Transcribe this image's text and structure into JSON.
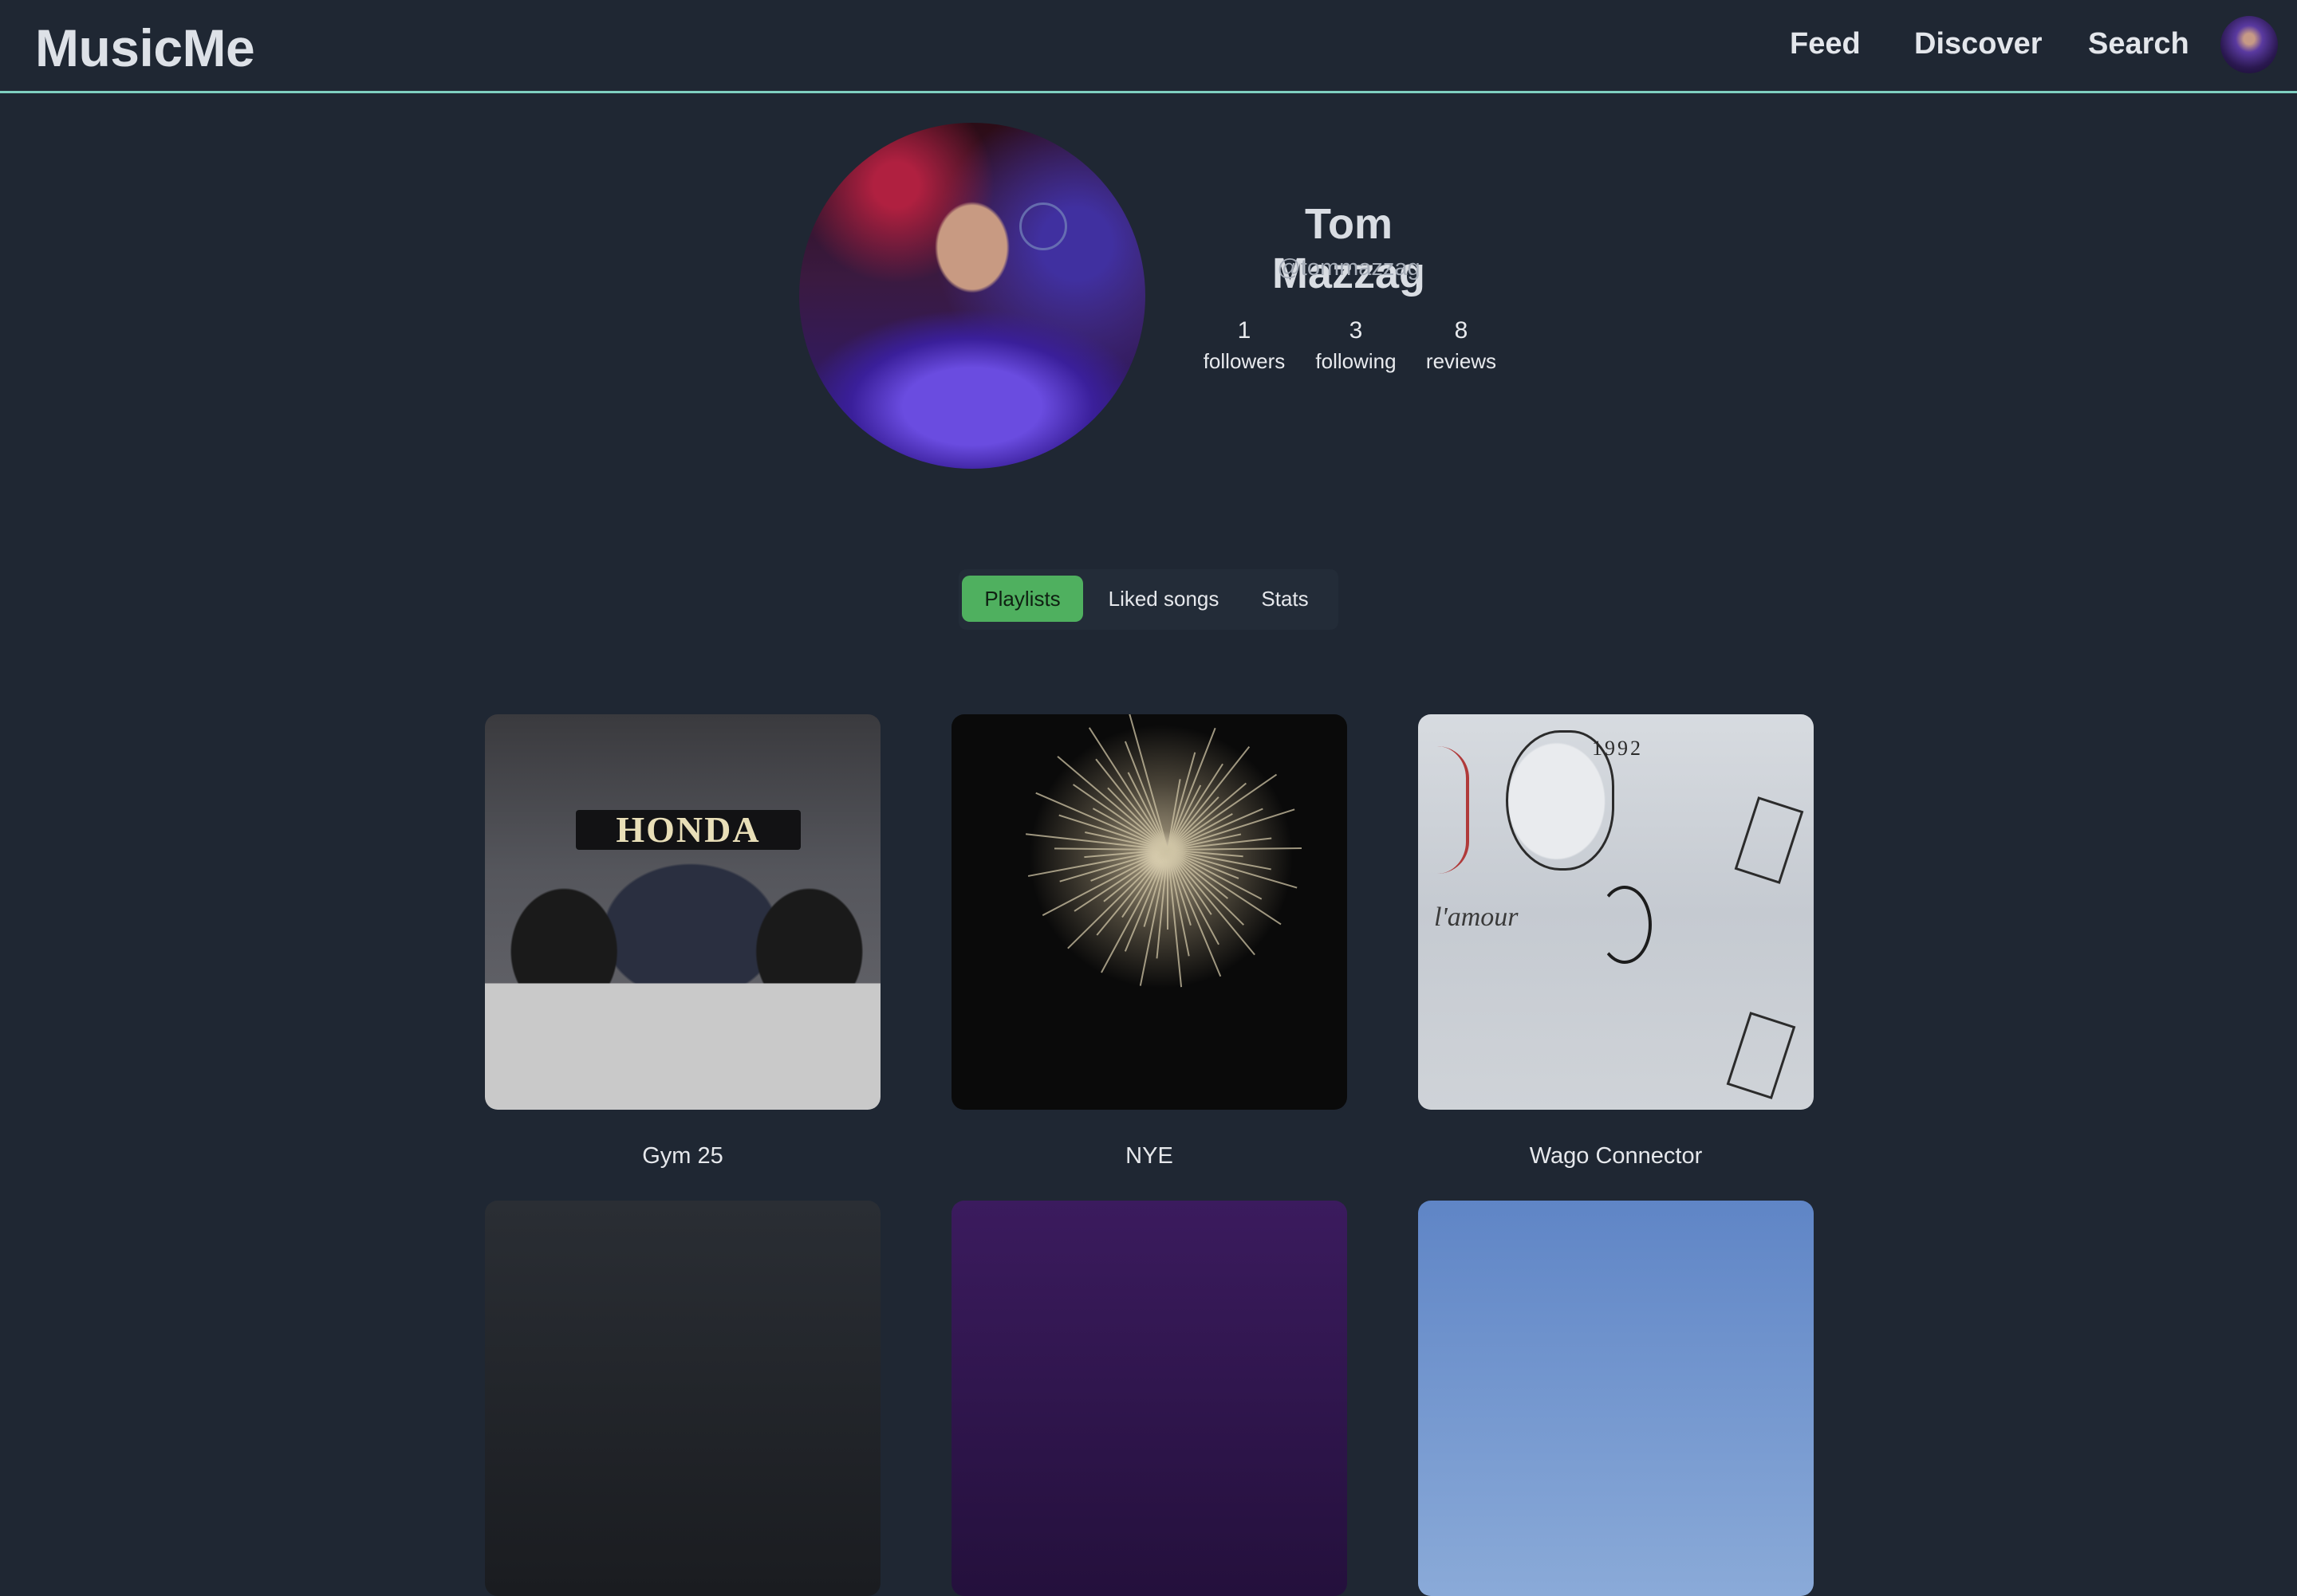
{
  "app": {
    "title": "MusicMe"
  },
  "nav": {
    "feed_label": "Feed",
    "discover_label": "Discover",
    "search_label": "Search"
  },
  "profile": {
    "name": "Tom Mazzag",
    "handle": "@tommazzag",
    "stats": {
      "followers": {
        "value": "1",
        "label": "followers"
      },
      "following": {
        "value": "3",
        "label": "following"
      },
      "reviews": {
        "value": "8",
        "label": "reviews"
      }
    }
  },
  "tabs": {
    "items": [
      {
        "label": "Playlists",
        "active": true
      },
      {
        "label": "Liked songs",
        "active": false
      },
      {
        "label": "Stats",
        "active": false
      }
    ]
  },
  "playlists": [
    {
      "title": "Gym 25",
      "cover_text": "HONDA"
    },
    {
      "title": "NYE"
    },
    {
      "title": "Wago Connector",
      "cover_text": [
        "1992",
        "l'amour"
      ]
    }
  ],
  "colors": {
    "background": "#1f2733",
    "nav_border": "#7fcfc0",
    "active_tab": "#4fb05f",
    "text": "#e6e8ec",
    "muted": "#a6adb8"
  }
}
